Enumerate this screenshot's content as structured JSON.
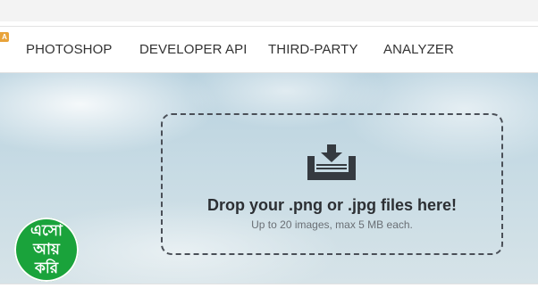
{
  "header": {
    "badge_text": "A"
  },
  "nav": {
    "items": [
      {
        "label": "PHOTOSHOP"
      },
      {
        "label": "DEVELOPER API"
      },
      {
        "label": "THIRD-PARTY"
      },
      {
        "label": "ANALYZER"
      }
    ]
  },
  "dropzone": {
    "icon": "download-tray-icon",
    "title": "Drop your .png or .jpg files here!",
    "subtitle": "Up to 20 images, max 5 MB each."
  },
  "logo": {
    "lines": [
      "এসো",
      "আয়",
      "করি"
    ],
    "color": "#1aa33b"
  },
  "colors": {
    "badge": "#e8a33a",
    "dropzone_border": "#4a4f57",
    "icon": "#353a40"
  }
}
